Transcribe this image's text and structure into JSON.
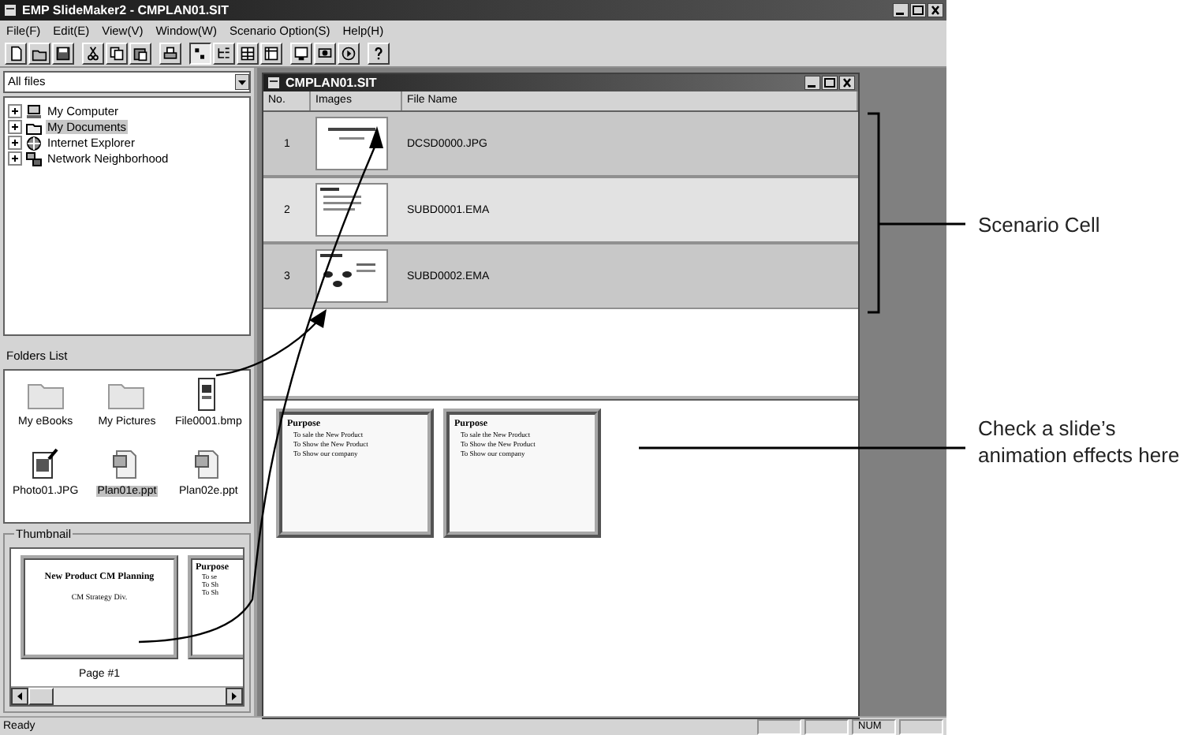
{
  "window": {
    "title": "EMP SlideMaker2 - CMPLAN01.SIT"
  },
  "menu": [
    "File(F)",
    "Edit(E)",
    "View(V)",
    "Window(W)",
    "Scenario Option(S)",
    "Help(H)"
  ],
  "toolbar": [
    [
      {
        "kind": "new",
        "pressed": false
      },
      {
        "kind": "open",
        "pressed": false
      },
      {
        "kind": "save",
        "pressed": false
      }
    ],
    [
      {
        "kind": "cut",
        "pressed": false
      },
      {
        "kind": "copy",
        "pressed": false
      },
      {
        "kind": "paste",
        "pressed": false
      }
    ],
    [
      {
        "kind": "print",
        "pressed": false
      }
    ],
    [
      {
        "kind": "list",
        "pressed": true
      },
      {
        "kind": "tree",
        "pressed": false
      },
      {
        "kind": "grid",
        "pressed": false
      },
      {
        "kind": "table",
        "pressed": false
      }
    ],
    [
      {
        "kind": "monitor",
        "pressed": false
      },
      {
        "kind": "display",
        "pressed": false
      },
      {
        "kind": "play",
        "pressed": false
      }
    ],
    [
      {
        "kind": "help",
        "pressed": false
      }
    ]
  ],
  "file_filter": {
    "value": "All files"
  },
  "tree": [
    {
      "kind": "computer",
      "label": "My Computer",
      "expanded": false,
      "selected": false
    },
    {
      "kind": "folder",
      "label": "My Documents",
      "expanded": false,
      "selected": true
    },
    {
      "kind": "globe",
      "label": "Internet Explorer",
      "expanded": false,
      "selected": false
    },
    {
      "kind": "network",
      "label": "Network Neighborhood",
      "expanded": false,
      "selected": false
    }
  ],
  "folders_list": {
    "title": "Folders List",
    "items": [
      {
        "kind": "folder",
        "name": "My eBooks",
        "selected": false
      },
      {
        "kind": "folder",
        "name": "My Pictures",
        "selected": false
      },
      {
        "kind": "image",
        "name": "File0001.bmp",
        "selected": false
      },
      {
        "kind": "photo",
        "name": "Photo01.JPG",
        "selected": false
      },
      {
        "kind": "presentation",
        "name": "Plan01e.ppt",
        "selected": true
      },
      {
        "kind": "presentation",
        "name": "Plan02e.ppt",
        "selected": false
      }
    ]
  },
  "thumbnail": {
    "title": "Thumbnail",
    "slides": [
      {
        "title": "New Product CM Planning",
        "subtitle": "CM Strategy Div.",
        "caption": "Page #1"
      },
      {
        "title": "Purpose",
        "bullets": [
          "To se",
          "To Sh",
          "To Sh"
        ]
      }
    ]
  },
  "scenario_window": {
    "title": "CMPLAN01.SIT",
    "columns": [
      "No.",
      "Images",
      "File Name"
    ],
    "rows": [
      {
        "no": "1",
        "kind": "title",
        "file_name": "DCSD0000.JPG",
        "selected": false
      },
      {
        "no": "2",
        "kind": "bullets",
        "file_name": "SUBD0001.EMA",
        "selected": true
      },
      {
        "no": "3",
        "kind": "diagram",
        "file_name": "SUBD0002.EMA",
        "selected": false
      }
    ],
    "animation_preview": [
      {
        "title": "Purpose",
        "bullets": [
          "To sale the New Product",
          "To Show the New Product",
          "To Show our company"
        ]
      },
      {
        "title": "Purpose",
        "bullets": [
          "To sale the New Product",
          "To Show the New Product",
          "To Show our company"
        ]
      }
    ]
  },
  "status_bar": {
    "text": "Ready",
    "indicator": "NUM"
  },
  "callouts": {
    "scenario_cell": {
      "text": "Scenario Cell"
    },
    "animation_effects": {
      "text": "Check a slide’s animation effects here"
    }
  }
}
